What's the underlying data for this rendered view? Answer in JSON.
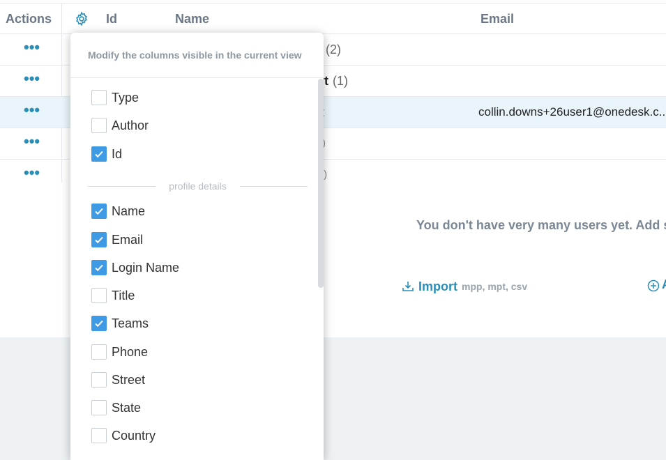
{
  "colors": {
    "accent": "#2a8fb8",
    "checkbox_checked": "#3f9ae6",
    "highlight_row": "#eaf5fb",
    "muted_text": "#6b7785"
  },
  "table": {
    "headers": {
      "actions": "Actions",
      "id": "Id",
      "name": "Name",
      "email": "Email"
    },
    "rows": [
      {
        "name_tail": "ı",
        "count": "(2)",
        "email": ""
      },
      {
        "name_tail": "rt",
        "count": "(1)",
        "email": ""
      },
      {
        "name_tail": "t",
        "count": "",
        "email": "collin.downs+26user1@onedesk.c..."
      },
      {
        "name_tail": ")",
        "count": "",
        "email": ""
      },
      {
        "name_tail": ".)",
        "count": "",
        "email": ""
      }
    ],
    "row_action_glyph": "•••"
  },
  "empty_state": {
    "message": "You don't have very many users yet. Add some",
    "import_label": "Import",
    "import_formats": "mpp, mpt, csv",
    "add_partial": "A"
  },
  "column_picker": {
    "description": "Modify the columns visible in the current view",
    "group_label": "profile details",
    "options_top": [
      {
        "label": "Type",
        "checked": false
      },
      {
        "label": "Author",
        "checked": false
      },
      {
        "label": "Id",
        "checked": true
      }
    ],
    "options_profile": [
      {
        "label": "Name",
        "checked": true
      },
      {
        "label": "Email",
        "checked": true
      },
      {
        "label": "Login Name",
        "checked": true
      },
      {
        "label": "Title",
        "checked": false
      },
      {
        "label": "Teams",
        "checked": true
      },
      {
        "label": "Phone",
        "checked": false
      },
      {
        "label": "Street",
        "checked": false
      },
      {
        "label": "State",
        "checked": false
      },
      {
        "label": "Country",
        "checked": false
      }
    ]
  }
}
